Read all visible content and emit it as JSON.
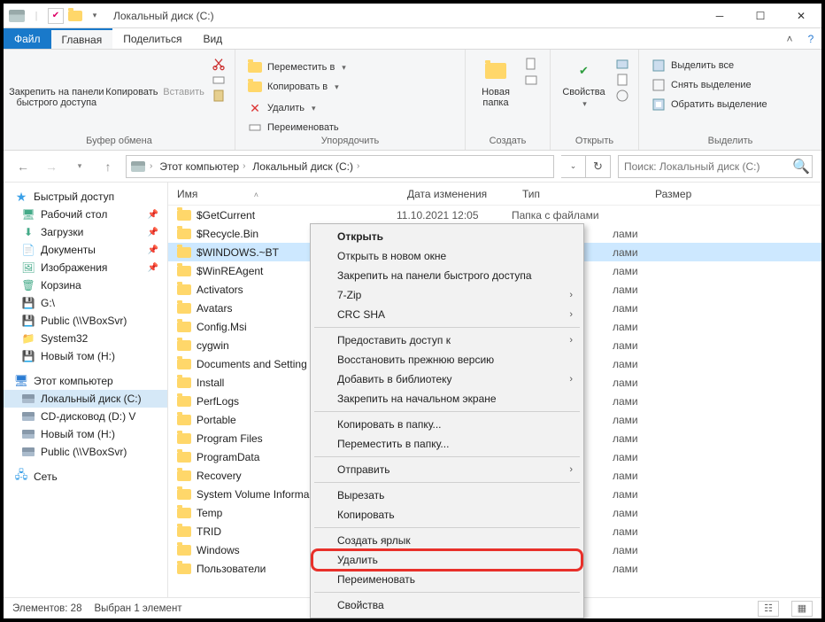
{
  "title": "Локальный диск (C:)",
  "tabs": {
    "file": "Файл",
    "home": "Главная",
    "share": "Поделиться",
    "view": "Вид"
  },
  "ribbon": {
    "clipboard": {
      "label": "Буфер обмена",
      "pin": "Закрепить на панели\nбыстрого доступа",
      "copy": "Копировать",
      "paste": "Вставить"
    },
    "organize": {
      "label": "Упорядочить",
      "move": "Переместить в",
      "copyto": "Копировать в",
      "delete": "Удалить",
      "rename": "Переименовать"
    },
    "new": {
      "label": "Создать",
      "newfolder": "Новая\nпапка"
    },
    "open": {
      "label": "Открыть",
      "props": "Свойства"
    },
    "select": {
      "label": "Выделить",
      "all": "Выделить все",
      "none": "Снять выделение",
      "invert": "Обратить выделение"
    }
  },
  "breadcrumb": {
    "pc": "Этот компьютер",
    "drive": "Локальный диск (C:)"
  },
  "search_placeholder": "Поиск: Локальный диск (C:)",
  "columns": {
    "name": "Имя",
    "date": "Дата изменения",
    "type": "Тип",
    "size": "Размер"
  },
  "type_folder": "Папка с файлами",
  "type_folder_suffix": "лами",
  "sidebar": {
    "quick": "Быстрый доступ",
    "quick_items": [
      "Рабочий стол",
      "Загрузки",
      "Документы",
      "Изображения",
      "Корзина",
      "G:\\",
      "Public (\\\\VBoxSvr)",
      "System32",
      "Новый том (H:)"
    ],
    "thispc": "Этот компьютер",
    "pc_items": [
      "Локальный диск (C:)",
      "CD-дисковод (D:) V",
      "Новый том (H:)",
      "Public (\\\\VBoxSvr)"
    ],
    "network": "Сеть"
  },
  "rows": [
    {
      "name": "$GetCurrent",
      "date": "11.10.2021 12:05"
    },
    {
      "name": "$Recycle.Bin"
    },
    {
      "name": "$WINDOWS.~BT"
    },
    {
      "name": "$WinREAgent"
    },
    {
      "name": "Activators"
    },
    {
      "name": "Avatars"
    },
    {
      "name": "Config.Msi"
    },
    {
      "name": "cygwin"
    },
    {
      "name": "Documents and Setting"
    },
    {
      "name": "Install"
    },
    {
      "name": "PerfLogs"
    },
    {
      "name": "Portable"
    },
    {
      "name": "Program Files"
    },
    {
      "name": "ProgramData"
    },
    {
      "name": "Recovery"
    },
    {
      "name": "System Volume Informa"
    },
    {
      "name": "Temp"
    },
    {
      "name": "TRID"
    },
    {
      "name": "Windows"
    },
    {
      "name": "Пользователи"
    }
  ],
  "ctx": {
    "open": "Открыть",
    "open_new": "Открыть в новом окне",
    "pin_quick": "Закрепить на панели быстрого доступа",
    "sevenzip": "7-Zip",
    "crc": "CRC SHA",
    "grant": "Предоставить доступ к",
    "restore": "Восстановить прежнюю версию",
    "library": "Добавить в библиотеку",
    "pin_start": "Закрепить на начальном экране",
    "copy_to": "Копировать в папку...",
    "move_to": "Переместить в папку...",
    "send": "Отправить",
    "cut": "Вырезать",
    "copy": "Копировать",
    "shortcut": "Создать ярлык",
    "delete": "Удалить",
    "rename": "Переименовать",
    "props": "Свойства"
  },
  "status": {
    "count": "Элементов: 28",
    "selected": "Выбран 1 элемент"
  }
}
